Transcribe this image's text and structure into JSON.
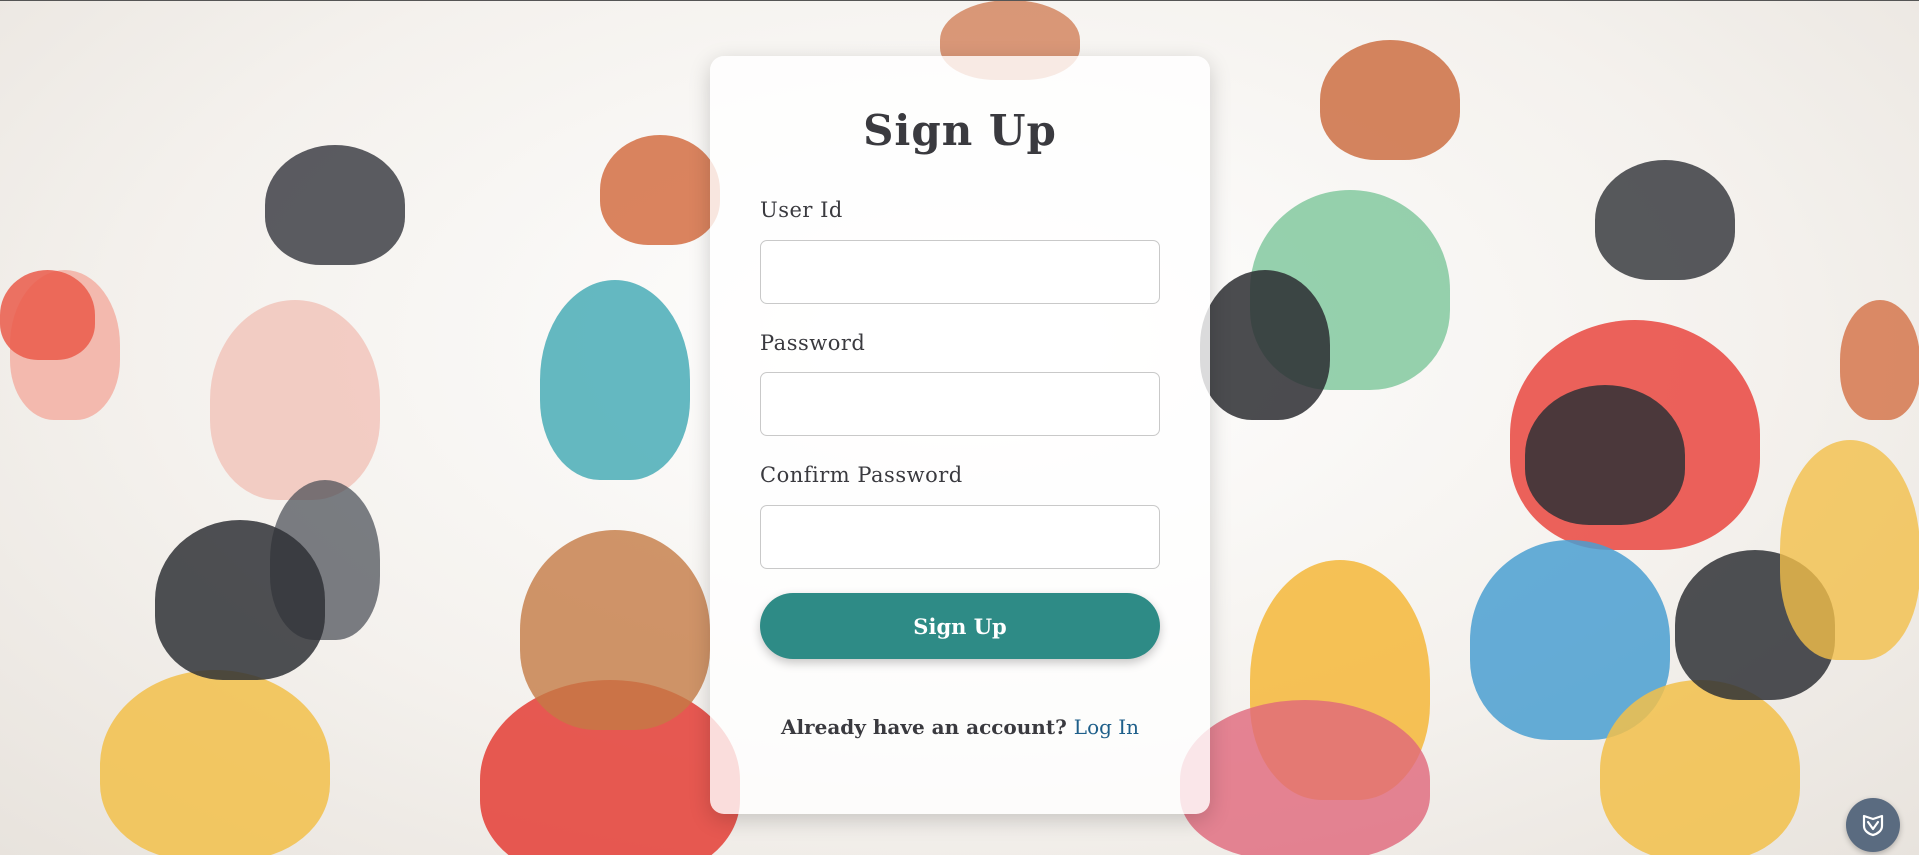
{
  "form": {
    "title": "Sign Up",
    "fields": [
      {
        "label": "User Id",
        "value": "",
        "placeholder": ""
      },
      {
        "label": "Password",
        "value": "",
        "placeholder": ""
      },
      {
        "label": "Confirm Password",
        "value": "",
        "placeholder": ""
      }
    ],
    "submit_label": "Sign Up",
    "footer_text": "Already have an account?",
    "login_link": "Log In"
  },
  "colors": {
    "accent": "#2e8b86",
    "link": "#1e5f8a",
    "text": "#3a3a3f",
    "widget": "#5a6b80"
  },
  "icons": {
    "widget": "shield-v-icon"
  }
}
